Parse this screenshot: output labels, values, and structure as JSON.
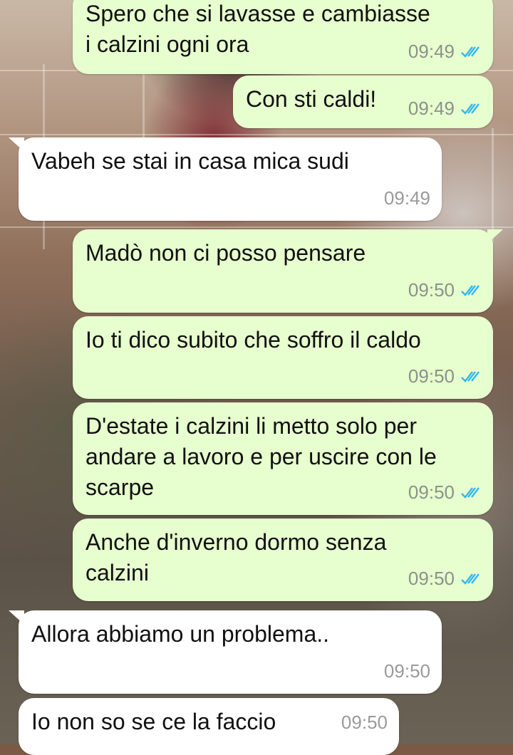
{
  "colors": {
    "outgoing_bubble": "#e7fece",
    "incoming_bubble": "#ffffff",
    "read_ticks": "#34b7f1"
  },
  "messages": [
    {
      "id": "m1",
      "direction": "outgoing",
      "text": "Spero che si lavasse e cambiasse\ni calzini ogni ora",
      "time": "09:49",
      "status": "read-ticks-icon"
    },
    {
      "id": "m2",
      "direction": "outgoing",
      "text": "Con sti caldi!",
      "time": "09:49",
      "status": "read-ticks-icon"
    },
    {
      "id": "m3",
      "direction": "incoming",
      "text": "Vabeh se stai in casa mica sudi",
      "time": "09:49"
    },
    {
      "id": "m4",
      "direction": "outgoing",
      "text": "Madò non ci posso pensare",
      "time": "09:50",
      "status": "read-ticks-icon"
    },
    {
      "id": "m5",
      "direction": "outgoing",
      "text": "Io ti dico subito che soffro il caldo",
      "time": "09:50",
      "status": "read-ticks-icon"
    },
    {
      "id": "m6",
      "direction": "outgoing",
      "text": "D'estate i calzini li metto solo per\nandare a lavoro e per uscire con le\nscarpe",
      "time": "09:50",
      "status": "read-ticks-icon"
    },
    {
      "id": "m7",
      "direction": "outgoing",
      "text": "Anche d'inverno dormo senza\ncalzini",
      "time": "09:50",
      "status": "read-ticks-icon"
    },
    {
      "id": "m8",
      "direction": "incoming",
      "text": "Allora abbiamo un problema..",
      "time": "09:50"
    },
    {
      "id": "m9",
      "direction": "incoming",
      "text": "Io non so se ce la faccio",
      "time": "09:50"
    }
  ]
}
